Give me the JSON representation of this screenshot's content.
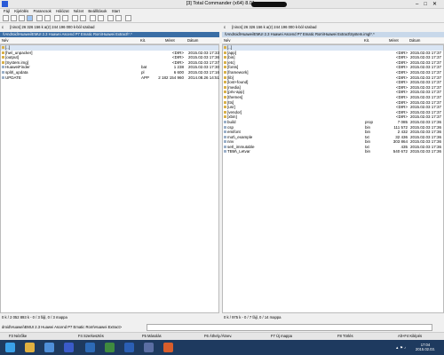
{
  "window": {
    "title": "[3] Total Commander (x64) 8.01 -"
  },
  "menu": [
    "Fájl",
    "Kijelölés",
    "Parancsok",
    "Hálózat",
    "Nézet",
    "Beállítások",
    "Start"
  ],
  "left": {
    "drive": "c",
    "drive_info": "[nincs]  26 326 156 k a(z) 244 196 000 k-ból szabad",
    "path": "\\\\Android\\Huawei\\EMUI 2.3 Huawei Ascend P7 Ematic Rom\\Huawei Extract\\*.*",
    "headers": {
      "name": "Név",
      "ext": "Kit.",
      "size": "Méret",
      "date": "Dátum"
    },
    "rows": [
      {
        "name": "[..]",
        "ext": "",
        "size": "",
        "date": ""
      },
      {
        "name": "[hw\\_unpacker]",
        "ext": "",
        "size": "<DIR>",
        "date": "2015.02.03 17:33"
      },
      {
        "name": "[output]",
        "ext": "",
        "size": "<DIR>",
        "date": "2015.02.03 17:36"
      },
      {
        "name": "[System.img]",
        "ext": "",
        "size": "<DIR>",
        "date": "2015.02.03 17:37"
      },
      {
        "name": "HuaweiFinder",
        "ext": "bat",
        "size": "1 238",
        "date": "2015.02.03 17:30"
      },
      {
        "name": "split\\_updata",
        "ext": "pl",
        "size": "6 600",
        "date": "2015.02.03 17:16"
      },
      {
        "name": "UPDATE",
        "ext": "APP",
        "size": "2 182 154 960",
        "date": "2014.08.26 14:51"
      }
    ],
    "status": "0 k / 2 052 893 k - 0 / 3 fájl, 0 / 3 mappa"
  },
  "right": {
    "drive": "c",
    "drive_info": "[nincs]  26 326 156 k a(z) 244 196 000 k-ból szabad",
    "path": "\\\\Android\\Huawei\\EMUI 2.3 Huawei Ascend P7 Ematic Rom\\Huawei Extract\\System.img\\*.*",
    "headers": {
      "name": "Név",
      "ext": "Kit.",
      "size": "Méret",
      "date": "Dátum"
    },
    "rows": [
      {
        "name": "[..]",
        "ext": "",
        "size": "",
        "date": ""
      },
      {
        "name": "[app]",
        "ext": "",
        "size": "<DIR>",
        "date": "2015.02.03 17:37"
      },
      {
        "name": "[bin]",
        "ext": "",
        "size": "<DIR>",
        "date": "2015.02.03 17:37"
      },
      {
        "name": "[etc]",
        "ext": "",
        "size": "<DIR>",
        "date": "2015.02.03 17:37"
      },
      {
        "name": "[fonts]",
        "ext": "",
        "size": "<DIR>",
        "date": "2015.02.03 17:37"
      },
      {
        "name": "[framework]",
        "ext": "",
        "size": "<DIR>",
        "date": "2015.02.03 17:37"
      },
      {
        "name": "[lib]",
        "ext": "",
        "size": "<DIR>",
        "date": "2015.02.03 17:37"
      },
      {
        "name": "[lost+found]",
        "ext": "",
        "size": "<DIR>",
        "date": "2015.02.03 17:37"
      },
      {
        "name": "[media]",
        "ext": "",
        "size": "<DIR>",
        "date": "2015.02.03 17:37"
      },
      {
        "name": "[priv-app]",
        "ext": "",
        "size": "<DIR>",
        "date": "2015.02.03 17:37"
      },
      {
        "name": "[themes]",
        "ext": "",
        "size": "<DIR>",
        "date": "2015.02.03 17:37"
      },
      {
        "name": "[tts]",
        "ext": "",
        "size": "<DIR>",
        "date": "2015.02.03 17:37"
      },
      {
        "name": "[usr]",
        "ext": "",
        "size": "<DIR>",
        "date": "2015.02.03 17:37"
      },
      {
        "name": "[vendor]",
        "ext": "",
        "size": "<DIR>",
        "date": "2015.02.03 17:37"
      },
      {
        "name": "[xbin]",
        "ext": "",
        "size": "<DIR>",
        "date": "2015.02.03 17:37"
      },
      {
        "name": "build",
        "ext": "prop",
        "size": "7 085",
        "date": "2015.02.03 17:36"
      },
      {
        "name": "csp",
        "ext": "bin",
        "size": "111 572",
        "date": "2015.02.03 17:36"
      },
      {
        "name": "emifont",
        "ext": "bin",
        "size": "2 432",
        "date": "2015.02.03 17:36"
      },
      {
        "name": "mot\\_example",
        "ext": "txt",
        "size": "32 436",
        "date": "2015.02.03 17:36"
      },
      {
        "name": "nnv",
        "ext": "bin",
        "size": "303 864",
        "date": "2015.02.03 17:36"
      },
      {
        "name": "set\\_immutable",
        "ext": "txt",
        "size": "435",
        "date": "2015.02.03 17:36"
      },
      {
        "name": "TBM\\_Letvar",
        "ext": "bin",
        "size": "540 672",
        "date": "2015.02.03 17:36"
      }
    ],
    "status": "0 k / 975 k - 0 / 7 fájl, 0 / 14 mappa"
  },
  "cmdline": {
    "path": "droid\\Huawei\\EMUI 2.3 Huawei Ascend P7 Ematic Rom\\Huawei Extract>"
  },
  "fkeys": [
    "F3 Nézőke",
    "F4 Szerkesztés",
    "F5 Másolás",
    "F6 Áthely./Átnev.",
    "F7 Új mappa",
    "F8 Törlés",
    "Alt+F4 Kilépés"
  ],
  "clock": {
    "time": "17:04",
    "date": "2015.02.03."
  }
}
